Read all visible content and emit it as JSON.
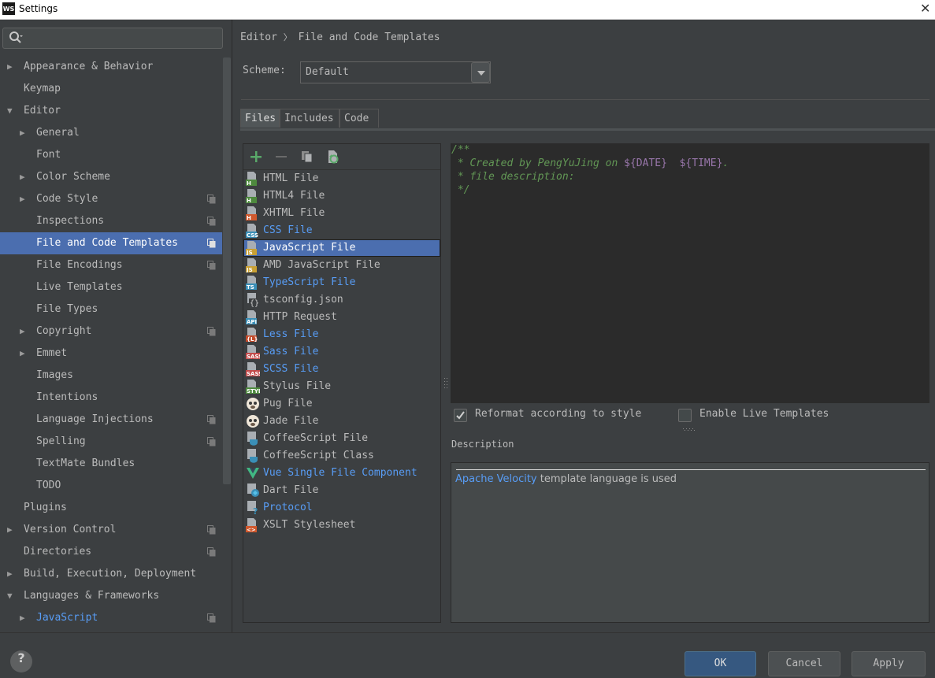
{
  "window": {
    "title": "Settings",
    "app_icon": "WS"
  },
  "search": {
    "placeholder": ""
  },
  "sidebar": {
    "items": [
      {
        "label": "Appearance & Behavior",
        "level": 0,
        "arrow": "right",
        "proj": false
      },
      {
        "label": "Keymap",
        "level": 0,
        "arrow": "",
        "proj": false
      },
      {
        "label": "Editor",
        "level": 0,
        "arrow": "down",
        "proj": false
      },
      {
        "label": "General",
        "level": 1,
        "arrow": "right",
        "proj": false
      },
      {
        "label": "Font",
        "level": 1,
        "arrow": "",
        "proj": false
      },
      {
        "label": "Color Scheme",
        "level": 1,
        "arrow": "right",
        "proj": false
      },
      {
        "label": "Code Style",
        "level": 1,
        "arrow": "right",
        "proj": true
      },
      {
        "label": "Inspections",
        "level": 1,
        "arrow": "",
        "proj": true
      },
      {
        "label": "File and Code Templates",
        "level": 1,
        "arrow": "",
        "proj": true,
        "selected": true
      },
      {
        "label": "File Encodings",
        "level": 1,
        "arrow": "",
        "proj": true
      },
      {
        "label": "Live Templates",
        "level": 1,
        "arrow": "",
        "proj": false
      },
      {
        "label": "File Types",
        "level": 1,
        "arrow": "",
        "proj": false
      },
      {
        "label": "Copyright",
        "level": 1,
        "arrow": "right",
        "proj": true
      },
      {
        "label": "Emmet",
        "level": 1,
        "arrow": "right",
        "proj": false
      },
      {
        "label": "Images",
        "level": 1,
        "arrow": "",
        "proj": false
      },
      {
        "label": "Intentions",
        "level": 1,
        "arrow": "",
        "proj": false
      },
      {
        "label": "Language Injections",
        "level": 1,
        "arrow": "",
        "proj": true
      },
      {
        "label": "Spelling",
        "level": 1,
        "arrow": "",
        "proj": true
      },
      {
        "label": "TextMate Bundles",
        "level": 1,
        "arrow": "",
        "proj": false
      },
      {
        "label": "TODO",
        "level": 1,
        "arrow": "",
        "proj": false
      },
      {
        "label": "Plugins",
        "level": 0,
        "arrow": "",
        "proj": false
      },
      {
        "label": "Version Control",
        "level": 0,
        "arrow": "right",
        "proj": true
      },
      {
        "label": "Directories",
        "level": 0,
        "arrow": "",
        "proj": true
      },
      {
        "label": "Build, Execution, Deployment",
        "level": 0,
        "arrow": "right",
        "proj": false
      },
      {
        "label": "Languages & Frameworks",
        "level": 0,
        "arrow": "down",
        "proj": false
      },
      {
        "label": "JavaScript",
        "level": 1,
        "arrow": "right",
        "proj": true,
        "blue": true
      }
    ]
  },
  "breadcrumb": {
    "part1": "Editor",
    "sep": "〉",
    "part2": "File and Code Templates"
  },
  "scheme": {
    "label": "Scheme:",
    "value": "Default"
  },
  "tabs": [
    {
      "label": "Files",
      "active": true
    },
    {
      "label": "Includes"
    },
    {
      "label": "Code"
    }
  ],
  "files": [
    {
      "name": "HTML File",
      "badge": "H",
      "color": "#4e8a3e",
      "blue": false
    },
    {
      "name": "HTML4 File",
      "badge": "H",
      "color": "#4e8a3e",
      "blue": false
    },
    {
      "name": "XHTML File",
      "badge": "H",
      "color": "#d0582d",
      "blue": false
    },
    {
      "name": "CSS File",
      "badge": "CSS",
      "color": "#3a8fb7",
      "blue": true
    },
    {
      "name": "JavaScript File",
      "badge": "JS",
      "color": "#c9a033",
      "blue": false,
      "selected": true
    },
    {
      "name": "AMD JavaScript File",
      "badge": "JS",
      "color": "#c9a033",
      "blue": false
    },
    {
      "name": "TypeScript File",
      "badge": "TS",
      "color": "#3a8fb7",
      "blue": true
    },
    {
      "name": "tsconfig.json",
      "badge": "{}",
      "color": "",
      "blue": false
    },
    {
      "name": "HTTP Request",
      "badge": "API",
      "color": "#3a8fb7",
      "blue": false
    },
    {
      "name": "Less File",
      "badge": "{L}",
      "color": "#c24a2a",
      "blue": true
    },
    {
      "name": "Sass File",
      "badge": "SASS",
      "color": "#c24a4a",
      "blue": true
    },
    {
      "name": "SCSS File",
      "badge": "SASS",
      "color": "#c24a4a",
      "blue": true
    },
    {
      "name": "Stylus File",
      "badge": "STYL",
      "color": "#4e8a3e",
      "blue": false
    },
    {
      "name": "Pug File",
      "badge": "pug",
      "color": "",
      "blue": false
    },
    {
      "name": "Jade File",
      "badge": "pug",
      "color": "",
      "blue": false
    },
    {
      "name": "CoffeeScript File",
      "badge": "coffee",
      "color": "#3a8fb7",
      "blue": false
    },
    {
      "name": "CoffeeScript Class",
      "badge": "coffee",
      "color": "#3a8fb7",
      "blue": false
    },
    {
      "name": "Vue Single File Component",
      "badge": "vue",
      "color": "#41b883",
      "blue": true
    },
    {
      "name": "Dart File",
      "badge": "dart",
      "color": "#3a8fb7",
      "blue": false
    },
    {
      "name": "Protocol",
      "badge": "?",
      "color": "#3a8fb7",
      "blue": true
    },
    {
      "name": "XSLT Stylesheet",
      "badge": "<>",
      "color": "#d0582d",
      "blue": false
    }
  ],
  "editor": {
    "line1": "/**",
    "line2_pre": " * Created by PengYuJing on ",
    "line2_var1": "${DATE}",
    "line2_mid": "  ",
    "line2_var2": "${TIME}",
    "line2_post": ".",
    "line3": " * file description:",
    "line4": " */"
  },
  "options": {
    "reformat": {
      "label": "Reformat according to style",
      "checked": true
    },
    "live": {
      "label": "Enable Live Templates",
      "checked": false
    }
  },
  "description": {
    "label": "Description",
    "link": "Apache Velocity",
    "text": " template language is used"
  },
  "buttons": {
    "ok": "OK",
    "cancel": "Cancel",
    "apply": "Apply",
    "help": "?"
  },
  "colors": {
    "accent": "#4b6eaf",
    "link": "#589df6",
    "comment": "#629755",
    "template_var": "#9876aa"
  }
}
